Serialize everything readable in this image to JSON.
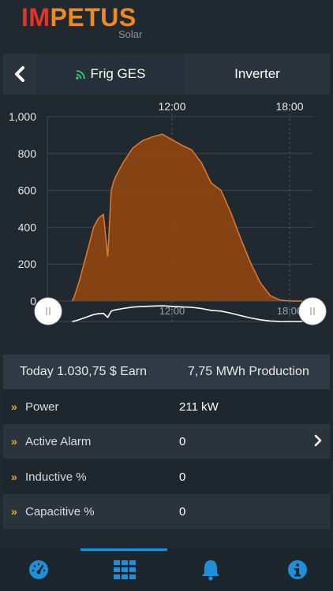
{
  "header": {
    "logo_im": "IM",
    "logo_petus": "PETUS",
    "logo_sub": "Solar"
  },
  "nav": {
    "back_icon": "chevron-left-icon",
    "site_icon": "signal-icon",
    "site_label": "Frig GES",
    "inverter_label": "Inverter"
  },
  "chart_data": {
    "type": "area",
    "x_ticks": [
      "12:00",
      "18:00"
    ],
    "y_ticks": [
      "1,000",
      "800",
      "600",
      "400",
      "200",
      "0"
    ],
    "ylim": [
      0,
      1000
    ],
    "navigator_ticks": [
      "12:00",
      "18:00"
    ],
    "series": [
      {
        "color": "#8b4513",
        "x": [
          6.9,
          7.0,
          7.25,
          7.5,
          7.75,
          8.0,
          8.25,
          8.5,
          8.72,
          8.9,
          9.0,
          9.1,
          9.5,
          10.0,
          10.5,
          11.0,
          11.5,
          12.0,
          12.5,
          13.0,
          13.5,
          14.0,
          14.5,
          15.0,
          15.5,
          16.0,
          16.5,
          17.0,
          17.5,
          18.0,
          18.5,
          18.65
        ],
        "values": [
          0,
          20,
          100,
          200,
          300,
          400,
          450,
          470,
          240,
          600,
          640,
          670,
          750,
          830,
          870,
          890,
          905,
          875,
          845,
          820,
          750,
          640,
          600,
          480,
          340,
          210,
          100,
          30,
          5,
          0,
          0,
          0
        ]
      }
    ]
  },
  "summary": {
    "earn": "Today 1.030,75 $ Earn",
    "production": "7,75 MWh Production"
  },
  "rows": [
    {
      "label": "Power",
      "value": "211 kW"
    },
    {
      "label": "Active Alarm",
      "value": "0"
    },
    {
      "label": "Inductive %",
      "value": "0"
    },
    {
      "label": "Capacitive %",
      "value": "0"
    }
  ],
  "tabs": [
    "dashboard-icon",
    "grid-icon",
    "bell-icon",
    "info-icon"
  ],
  "colors": {
    "accent": "#1e8fd8",
    "bullet": "#e0b23a",
    "chart_fill": "#8b4513",
    "chart_line": "#e07a30"
  }
}
